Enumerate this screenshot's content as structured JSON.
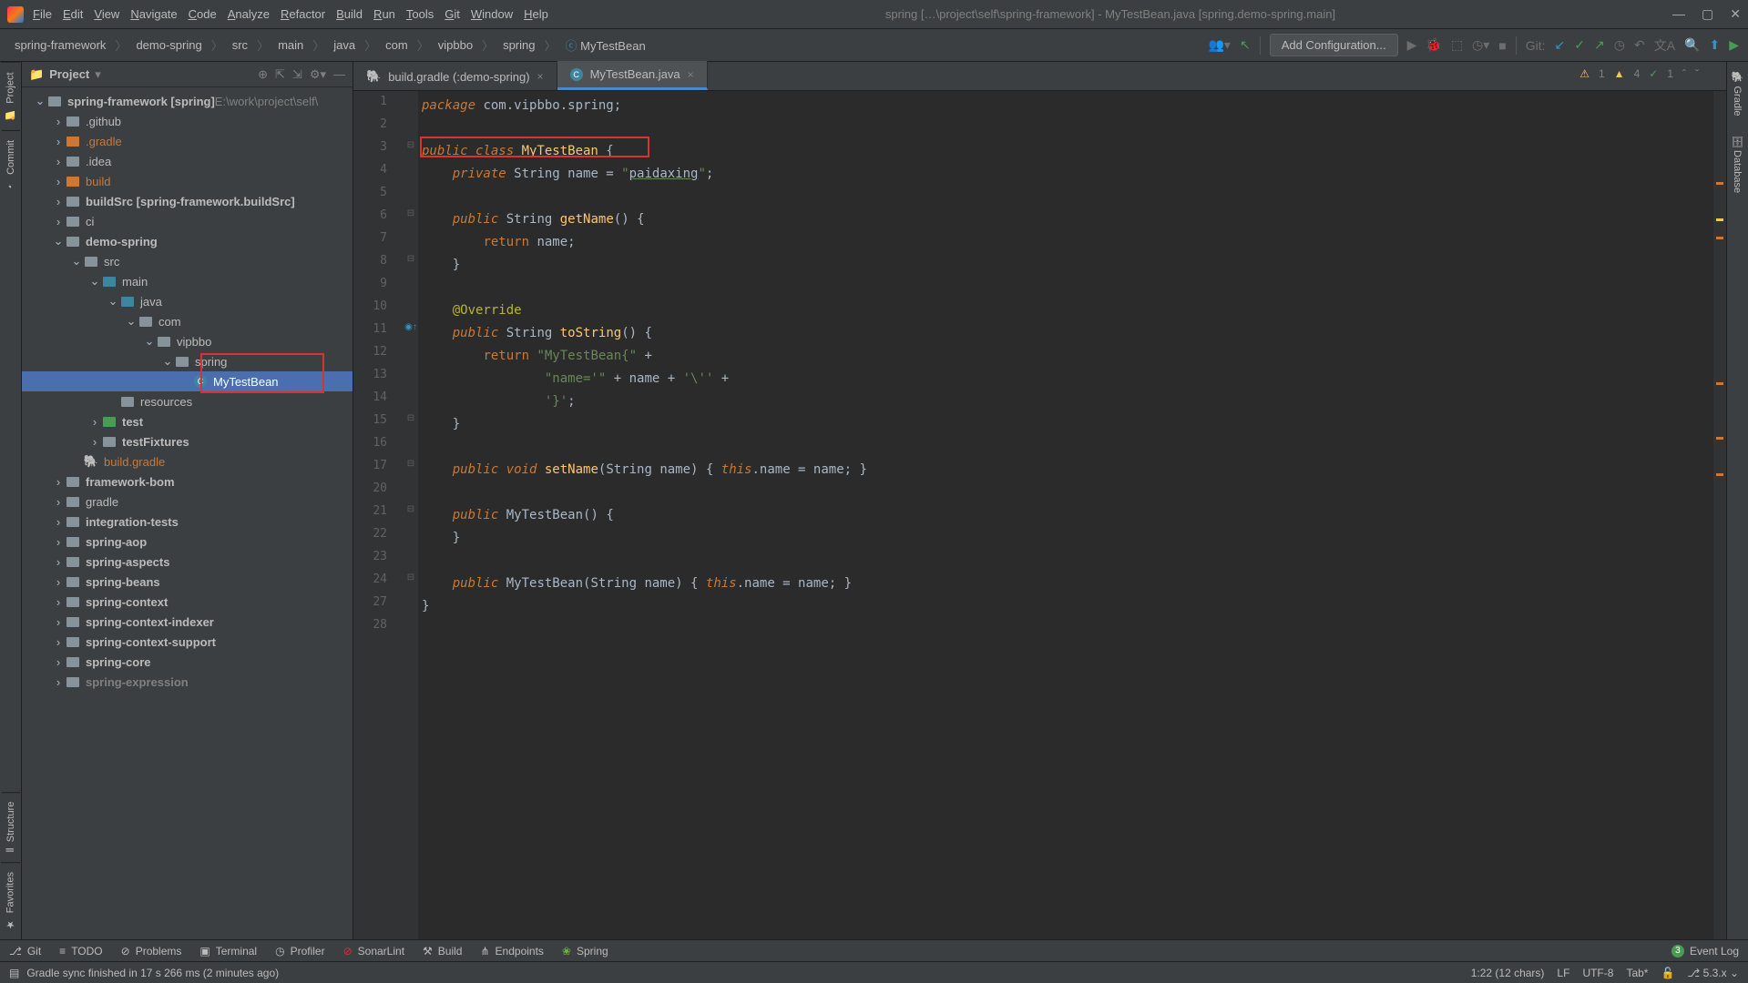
{
  "window": {
    "title": "spring […\\project\\self\\spring-framework] - MyTestBean.java [spring.demo-spring.main]"
  },
  "menu": [
    "File",
    "Edit",
    "View",
    "Navigate",
    "Code",
    "Analyze",
    "Refactor",
    "Build",
    "Run",
    "Tools",
    "Git",
    "Window",
    "Help"
  ],
  "toolbar": {
    "breadcrumb": [
      "spring-framework",
      "demo-spring",
      "src",
      "main",
      "java",
      "com",
      "vipbbo",
      "spring",
      "MyTestBean"
    ],
    "add_config": "Add Configuration...",
    "git_label": "Git:"
  },
  "left_tabs": {
    "project": "Project",
    "commit": "Commit",
    "structure": "Structure",
    "favorites": "Favorites"
  },
  "right_tabs": {
    "gradle": "Gradle",
    "database": "Database"
  },
  "project_panel": {
    "title": "Project",
    "root_path": "E:\\work\\project\\self\\",
    "tree": [
      {
        "indent": 0,
        "arrow": "v",
        "icon": "folder",
        "label": "spring-framework [spring]",
        "bold": true
      },
      {
        "indent": 1,
        "arrow": ">",
        "icon": "folder",
        "label": ".github"
      },
      {
        "indent": 1,
        "arrow": ">",
        "icon": "folder-orange",
        "label": ".gradle",
        "orange": true
      },
      {
        "indent": 1,
        "arrow": ">",
        "icon": "folder",
        "label": ".idea"
      },
      {
        "indent": 1,
        "arrow": ">",
        "icon": "folder-orange",
        "label": "build",
        "orange": true
      },
      {
        "indent": 1,
        "arrow": ">",
        "icon": "folder",
        "label": "buildSrc [spring-framework.buildSrc]",
        "bold": true
      },
      {
        "indent": 1,
        "arrow": ">",
        "icon": "folder",
        "label": "ci"
      },
      {
        "indent": 1,
        "arrow": "v",
        "icon": "folder",
        "label": "demo-spring",
        "bold": true
      },
      {
        "indent": 2,
        "arrow": "v",
        "icon": "folder",
        "label": "src"
      },
      {
        "indent": 3,
        "arrow": "v",
        "icon": "folder-blue",
        "label": "main"
      },
      {
        "indent": 4,
        "arrow": "v",
        "icon": "folder-blue",
        "label": "java"
      },
      {
        "indent": 5,
        "arrow": "v",
        "icon": "folder",
        "label": "com"
      },
      {
        "indent": 6,
        "arrow": "v",
        "icon": "folder",
        "label": "vipbbo"
      },
      {
        "indent": 7,
        "arrow": "v",
        "icon": "folder",
        "label": "spring"
      },
      {
        "indent": 8,
        "arrow": "",
        "icon": "class",
        "label": "MyTestBean",
        "selected": true
      },
      {
        "indent": 4,
        "arrow": "",
        "icon": "folder",
        "label": "resources"
      },
      {
        "indent": 3,
        "arrow": ">",
        "icon": "folder-teal",
        "label": "test",
        "bold": true
      },
      {
        "indent": 3,
        "arrow": ">",
        "icon": "folder",
        "label": "testFixtures",
        "bold": true
      },
      {
        "indent": 2,
        "arrow": "",
        "icon": "gradle",
        "label": "build.gradle",
        "orange": true
      },
      {
        "indent": 1,
        "arrow": ">",
        "icon": "folder",
        "label": "framework-bom",
        "bold": true
      },
      {
        "indent": 1,
        "arrow": ">",
        "icon": "folder",
        "label": "gradle"
      },
      {
        "indent": 1,
        "arrow": ">",
        "icon": "folder",
        "label": "integration-tests",
        "bold": true
      },
      {
        "indent": 1,
        "arrow": ">",
        "icon": "folder",
        "label": "spring-aop",
        "bold": true
      },
      {
        "indent": 1,
        "arrow": ">",
        "icon": "folder",
        "label": "spring-aspects",
        "bold": true
      },
      {
        "indent": 1,
        "arrow": ">",
        "icon": "folder",
        "label": "spring-beans",
        "bold": true
      },
      {
        "indent": 1,
        "arrow": ">",
        "icon": "folder",
        "label": "spring-context",
        "bold": true
      },
      {
        "indent": 1,
        "arrow": ">",
        "icon": "folder",
        "label": "spring-context-indexer",
        "bold": true
      },
      {
        "indent": 1,
        "arrow": ">",
        "icon": "folder",
        "label": "spring-context-support",
        "bold": true
      },
      {
        "indent": 1,
        "arrow": ">",
        "icon": "folder",
        "label": "spring-core",
        "bold": true
      },
      {
        "indent": 1,
        "arrow": ">",
        "icon": "folder",
        "label": "spring-expression",
        "bold": true,
        "dim": true
      }
    ]
  },
  "tabs": [
    {
      "icon": "gradle",
      "label": "build.gradle (:demo-spring)",
      "active": false
    },
    {
      "icon": "class",
      "label": "MyTestBean.java",
      "active": true
    }
  ],
  "inspections": {
    "warn": "1",
    "weak": "4",
    "ok": "1"
  },
  "code": {
    "line_numbers": [
      1,
      2,
      3,
      4,
      5,
      6,
      7,
      8,
      9,
      10,
      11,
      12,
      13,
      14,
      15,
      16,
      17,
      20,
      21,
      22,
      23,
      24,
      27,
      28
    ],
    "lines": [
      {
        "t": "package com.vipbbo.spring;",
        "tokens": [
          [
            "kw",
            "package "
          ],
          [
            "type",
            "com.vipbbo.spring"
          ],
          [
            "type",
            ";"
          ]
        ]
      },
      {
        "t": ""
      },
      {
        "t": "public class MyTestBean {",
        "tokens": [
          [
            "kw",
            "public class "
          ],
          [
            "fn",
            "MyTestBean"
          ],
          [
            "curly",
            " {"
          ]
        ]
      },
      {
        "t": "    private String name = \"paidaxing\";",
        "tokens": [
          [
            "type",
            "    "
          ],
          [
            "kw",
            "private "
          ],
          [
            "type",
            "String name = "
          ],
          [
            "str",
            "\""
          ],
          [
            "underline",
            "paidaxing"
          ],
          [
            "str",
            "\""
          ],
          [
            "type",
            ";"
          ]
        ]
      },
      {
        "t": ""
      },
      {
        "t": "    public String getName() {",
        "tokens": [
          [
            "type",
            "    "
          ],
          [
            "kw",
            "public "
          ],
          [
            "type",
            "String "
          ],
          [
            "fn",
            "getName"
          ],
          [
            "type",
            "() "
          ],
          [
            "curly",
            "{"
          ]
        ]
      },
      {
        "t": "        return name;",
        "tokens": [
          [
            "type",
            "        "
          ],
          [
            "kw-plain",
            "return "
          ],
          [
            "type",
            "name;"
          ]
        ]
      },
      {
        "t": "    }",
        "tokens": [
          [
            "curly",
            "    }"
          ]
        ]
      },
      {
        "t": ""
      },
      {
        "t": "    @Override",
        "tokens": [
          [
            "type",
            "    "
          ],
          [
            "anno",
            "@Override"
          ]
        ]
      },
      {
        "t": "    public String toString() {",
        "tokens": [
          [
            "type",
            "    "
          ],
          [
            "kw",
            "public "
          ],
          [
            "type",
            "String "
          ],
          [
            "fn",
            "toString"
          ],
          [
            "type",
            "() "
          ],
          [
            "curly",
            "{"
          ]
        ]
      },
      {
        "t": "        return \"MyTestBean{\" +",
        "tokens": [
          [
            "type",
            "        "
          ],
          [
            "kw-plain",
            "return "
          ],
          [
            "str",
            "\"MyTestBean{\""
          ],
          [
            "type",
            " +"
          ]
        ]
      },
      {
        "t": "                \"name='\" + name + '\\'' +",
        "tokens": [
          [
            "type",
            "                "
          ],
          [
            "str",
            "\"name='\""
          ],
          [
            "type",
            " + name + "
          ],
          [
            "str",
            "'\\''"
          ],
          [
            "type",
            " +"
          ]
        ]
      },
      {
        "t": "                '}';",
        "tokens": [
          [
            "type",
            "                "
          ],
          [
            "str",
            "'}'"
          ],
          [
            "type",
            ";"
          ]
        ]
      },
      {
        "t": "    }",
        "tokens": [
          [
            "curly",
            "    }"
          ]
        ]
      },
      {
        "t": ""
      },
      {
        "t": "    public void setName(String name) { this.name = name; }",
        "tokens": [
          [
            "type",
            "    "
          ],
          [
            "kw",
            "public void "
          ],
          [
            "fn",
            "setName"
          ],
          [
            "type",
            "(String name) "
          ],
          [
            "curly",
            "{ "
          ],
          [
            "kw",
            "this"
          ],
          [
            "type",
            ".name = name;"
          ],
          [
            "curly",
            " }"
          ]
        ]
      },
      {
        "t": ""
      },
      {
        "t": "    public MyTestBean() {",
        "tokens": [
          [
            "type",
            "    "
          ],
          [
            "kw",
            "public "
          ],
          [
            "type",
            "MyTestBean() "
          ],
          [
            "curly",
            "{"
          ]
        ]
      },
      {
        "t": "    }",
        "tokens": [
          [
            "curly",
            "    }"
          ]
        ]
      },
      {
        "t": ""
      },
      {
        "t": "    public MyTestBean(String name) { this.name = name; }",
        "tokens": [
          [
            "type",
            "    "
          ],
          [
            "kw",
            "public "
          ],
          [
            "type",
            "MyTestBean(String name) "
          ],
          [
            "curly",
            "{ "
          ],
          [
            "kw",
            "this"
          ],
          [
            "type",
            ".name = name;"
          ],
          [
            "curly",
            " }"
          ]
        ]
      },
      {
        "t": "}",
        "tokens": [
          [
            "curly",
            "}"
          ]
        ]
      },
      {
        "t": ""
      }
    ]
  },
  "bottom_tools": {
    "git": "Git",
    "todo": "TODO",
    "problems": "Problems",
    "terminal": "Terminal",
    "profiler": "Profiler",
    "sonarlint": "SonarLint",
    "build": "Build",
    "endpoints": "Endpoints",
    "spring": "Spring",
    "event_log": "Event Log",
    "event_count": "3"
  },
  "status": {
    "message": "Gradle sync finished in 17 s 266 ms (2 minutes ago)",
    "pos": "1:22 (12 chars)",
    "eol": "LF",
    "enc": "UTF-8",
    "indent": "Tab*",
    "branch": "5.3.x",
    "lock": "🔓"
  }
}
